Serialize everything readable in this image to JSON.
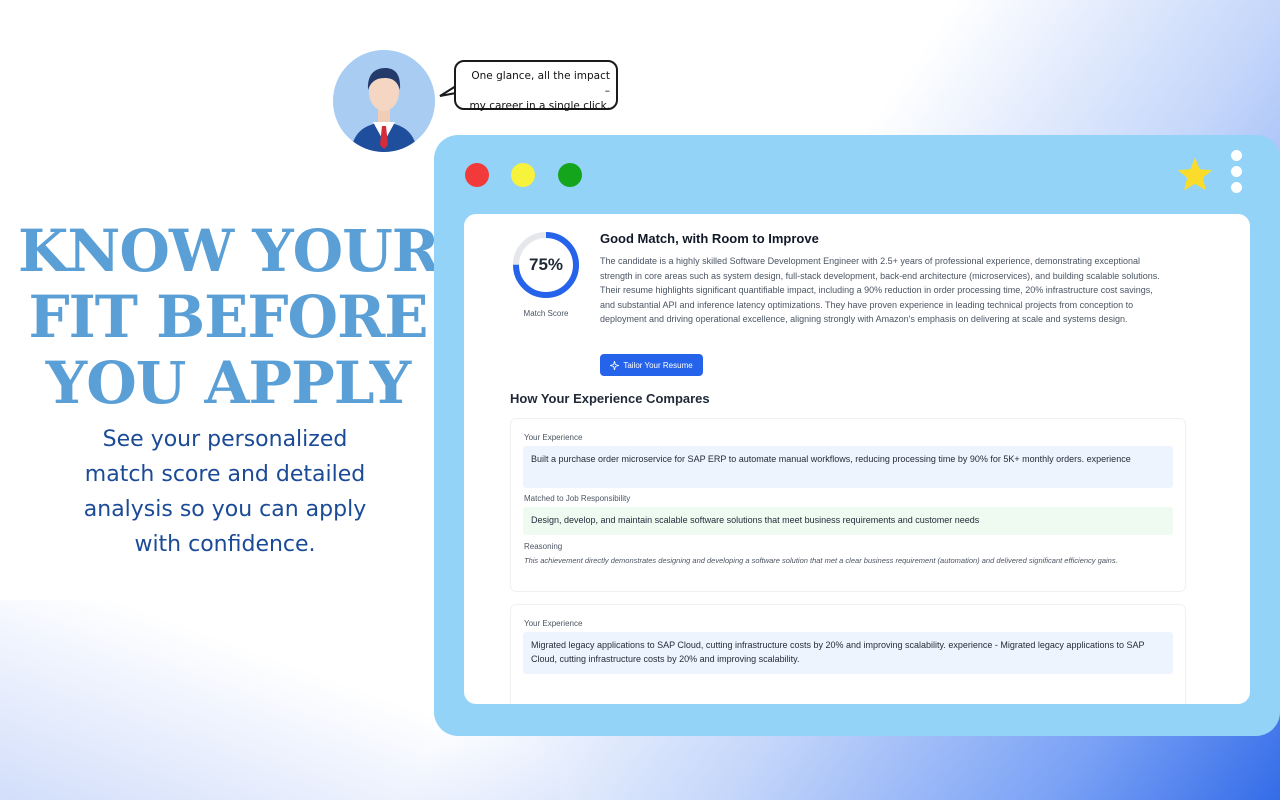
{
  "hero": {
    "headline_lines": [
      "KNOW YOUR",
      "FIT BEFORE",
      "YOU APPLY"
    ],
    "subhead_lines": [
      "See your personalized",
      "match score and detailed",
      "analysis so you can apply",
      "with confidence."
    ]
  },
  "testimonial": {
    "line1": "One glance, all the impact –",
    "line2": "my career in a single click."
  },
  "window": {
    "controls": [
      "close",
      "minimize",
      "maximize"
    ],
    "colors": {
      "frame": "#93d3f7",
      "red": "#f23a3a",
      "yellow": "#f7f23c",
      "green": "#14a51c",
      "star": "#fbdc2b"
    }
  },
  "match": {
    "score": 75,
    "score_text": "75%",
    "score_label": "Match Score",
    "title": "Good Match, with Room to Improve",
    "summary": "The candidate is a highly skilled Software Development Engineer with 2.5+ years of professional experience, demonstrating exceptional strength in core areas such as system design, full-stack development, back-end architecture (microservices), and building scalable solutions. Their resume highlights significant quantifiable impact, including a 90% reduction in order processing time, 20% infrastructure cost savings, and substantial API and inference latency optimizations. They have proven experience in leading technical projects from conception to deployment and driving operational excellence, aligning strongly with Amazon's emphasis on delivering at scale and systems design.",
    "tailor_button": "Tailor Your Resume",
    "accent": "#2563eb"
  },
  "compare": {
    "title": "How Your Experience Compares",
    "cards": [
      {
        "experience_label": "Your Experience",
        "experience": "Built a purchase order microservice for SAP ERP to automate manual workflows, reducing processing time by 90% for 5K+ monthly orders. experience",
        "matched_label": "Matched to Job Responsibility",
        "matched": "Design, develop, and maintain scalable software solutions that meet business requirements and customer needs",
        "reasoning_label": "Reasoning",
        "reasoning": "This achievement directly demonstrates designing and developing a software solution that met a clear business requirement (automation) and delivered significant efficiency gains."
      },
      {
        "experience_label": "Your Experience",
        "experience": "Migrated legacy applications to SAP Cloud, cutting infrastructure costs by 20% and improving scalability. experience - Migrated legacy applications to SAP Cloud, cutting infrastructure costs by 20% and improving scalability."
      }
    ]
  }
}
